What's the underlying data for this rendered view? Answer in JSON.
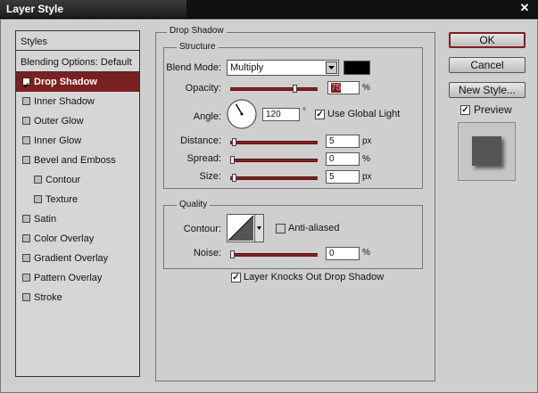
{
  "window": {
    "title": "Layer Style",
    "close_glyph": "✕"
  },
  "sidebar": {
    "header": "Styles",
    "blending_options": "Blending Options: Default",
    "items": [
      {
        "label": "Drop Shadow",
        "checked": true,
        "active": true,
        "sub": false
      },
      {
        "label": "Inner Shadow",
        "checked": false,
        "active": false,
        "sub": false
      },
      {
        "label": "Outer Glow",
        "checked": false,
        "active": false,
        "sub": false
      },
      {
        "label": "Inner Glow",
        "checked": false,
        "active": false,
        "sub": false
      },
      {
        "label": "Bevel and Emboss",
        "checked": false,
        "active": false,
        "sub": false
      },
      {
        "label": "Contour",
        "checked": false,
        "active": false,
        "sub": true
      },
      {
        "label": "Texture",
        "checked": false,
        "active": false,
        "sub": true
      },
      {
        "label": "Satin",
        "checked": false,
        "active": false,
        "sub": false
      },
      {
        "label": "Color Overlay",
        "checked": false,
        "active": false,
        "sub": false
      },
      {
        "label": "Gradient Overlay",
        "checked": false,
        "active": false,
        "sub": false
      },
      {
        "label": "Pattern Overlay",
        "checked": false,
        "active": false,
        "sub": false
      },
      {
        "label": "Stroke",
        "checked": false,
        "active": false,
        "sub": false
      }
    ]
  },
  "drop_shadow": {
    "legend": "Drop Shadow",
    "structure": {
      "legend": "Structure",
      "blend_mode_label": "Blend Mode:",
      "blend_mode_value": "Multiply",
      "blend_color": "#000000",
      "opacity_label": "Opacity:",
      "opacity_value": "75",
      "opacity_unit": "%",
      "opacity_fraction": 0.75,
      "angle_label": "Angle:",
      "angle_value": "120",
      "angle_unit": "°",
      "use_global_light_label": "Use Global Light",
      "use_global_light": true,
      "distance_label": "Distance:",
      "distance_value": "5",
      "distance_unit": "px",
      "distance_fraction": 0.02,
      "spread_label": "Spread:",
      "spread_value": "0",
      "spread_unit": "%",
      "spread_fraction": 0,
      "size_label": "Size:",
      "size_value": "5",
      "size_unit": "px",
      "size_fraction": 0.02
    },
    "quality": {
      "legend": "Quality",
      "contour_label": "Contour:",
      "anti_aliased_label": "Anti-aliased",
      "anti_aliased": false,
      "noise_label": "Noise:",
      "noise_value": "0",
      "noise_unit": "%",
      "noise_fraction": 0
    },
    "knockout_label": "Layer Knocks Out Drop Shadow",
    "knockout": true
  },
  "buttons": {
    "ok": "OK",
    "cancel": "Cancel",
    "new_style": "New Style..."
  },
  "preview": {
    "label": "Preview",
    "checked": true
  },
  "colors": {
    "accent": "#7a2020",
    "slider": "#9e2b2b"
  }
}
